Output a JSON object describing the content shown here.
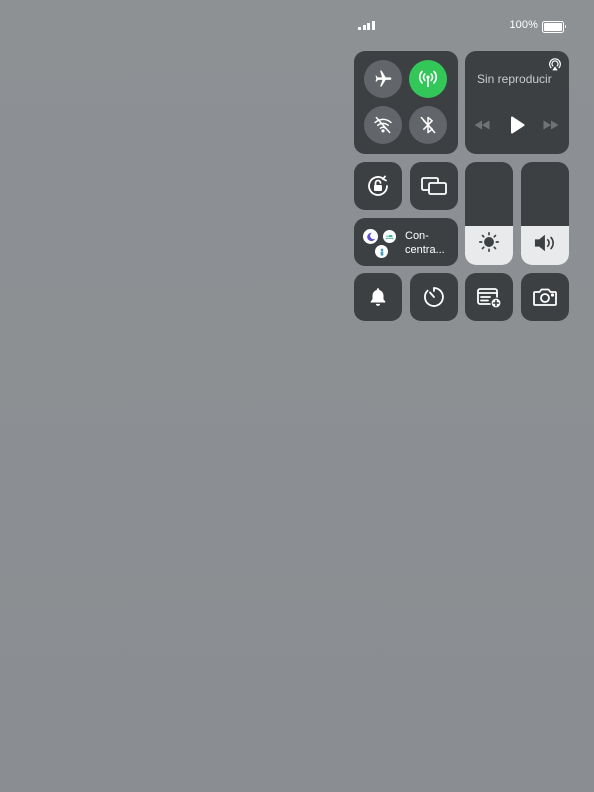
{
  "status_bar": {
    "battery_percent_text": "100%",
    "signal_bars": 4,
    "battery_level": 1.0
  },
  "connectivity": {
    "airplane_icon": "airplane-icon",
    "cellular_icon": "cellular-antenna-icon",
    "cellular_active": true,
    "wifi_icon": "wifi-off-icon",
    "bluetooth_icon": "bluetooth-off-icon"
  },
  "media": {
    "title": "Sin reproducir",
    "airplay_icon": "airplay-audio-icon",
    "rewind_icon": "rewind-icon",
    "play_icon": "play-icon",
    "forward_icon": "fast-forward-icon"
  },
  "focus": {
    "label_line1": "Con-",
    "label_line2": "centra..."
  },
  "brightness": {
    "level": 0.38,
    "icon": "sun-icon"
  },
  "volume": {
    "level": 0.38,
    "icon": "speaker-icon"
  },
  "colors": {
    "background": "#8b8f93",
    "tile": "#3d4043",
    "circle_inactive": "#62666a",
    "active_green": "#33c759",
    "slider_fill": "#e9eaeb"
  }
}
